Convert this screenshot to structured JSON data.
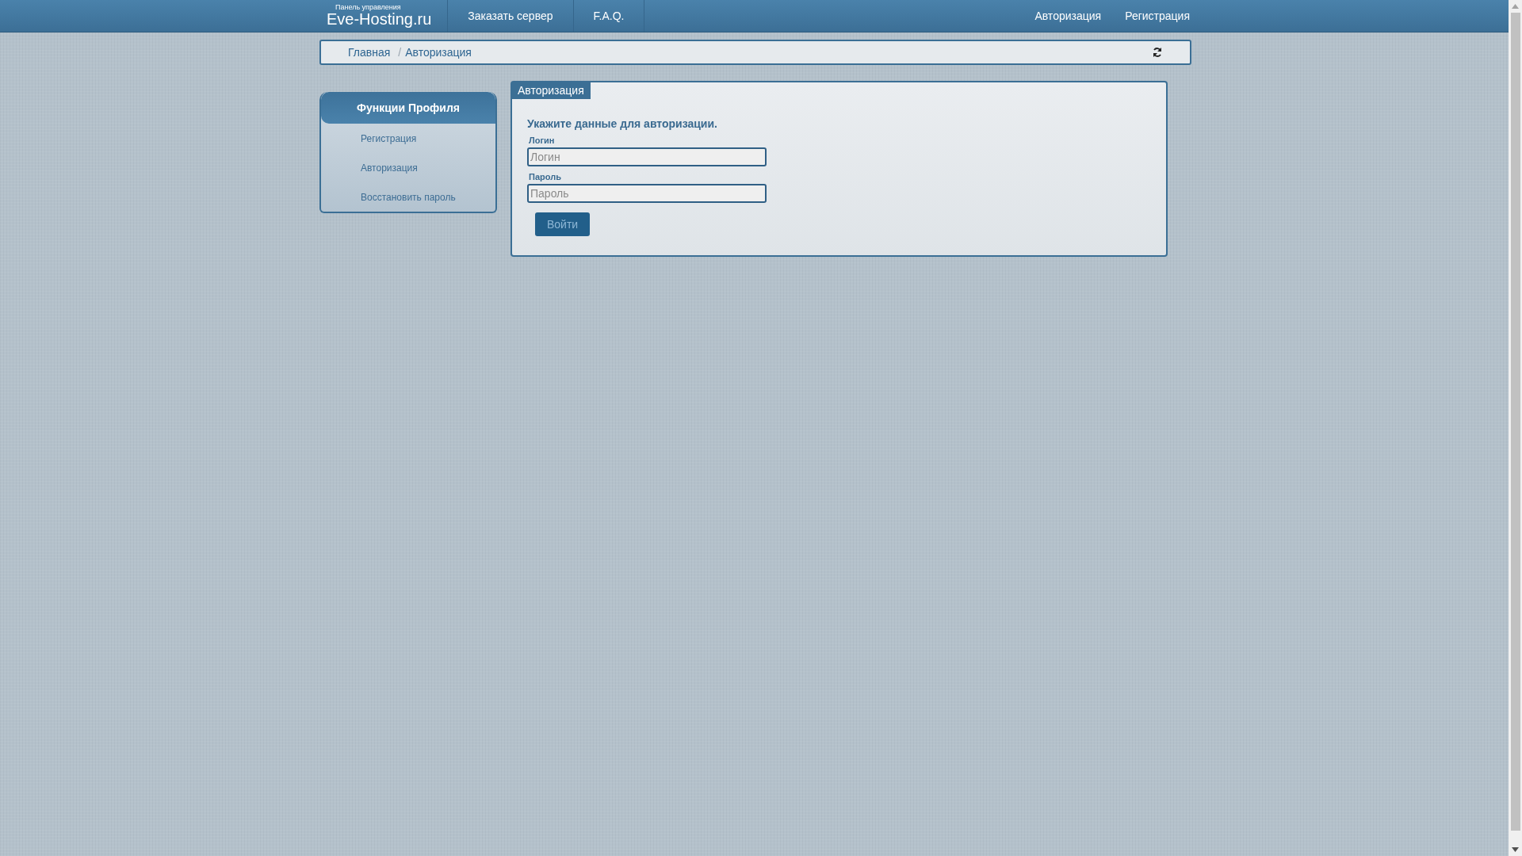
{
  "header": {
    "logo": {
      "subtitle": "Панель управления",
      "title": "Eve-Hosting.ru"
    },
    "nav_left": [
      "Заказать сервер",
      "F.A.Q."
    ],
    "nav_right": [
      "Авторизация",
      "Регистрация"
    ]
  },
  "breadcrumb": {
    "separator": "/",
    "items": [
      "Главная",
      "Авторизация"
    ]
  },
  "sidebar": {
    "title": "Функции Профиля",
    "items": [
      "Регистрация",
      "Авторизация",
      "Восстановить пароль"
    ]
  },
  "panel": {
    "tab": "Авторизация",
    "heading": "Укажите данные для авторизации.",
    "fields": [
      {
        "label": "Логин",
        "placeholder": "Логин"
      },
      {
        "label": "Пароль",
        "placeholder": "Пароль"
      }
    ],
    "submit": "Войти"
  }
}
